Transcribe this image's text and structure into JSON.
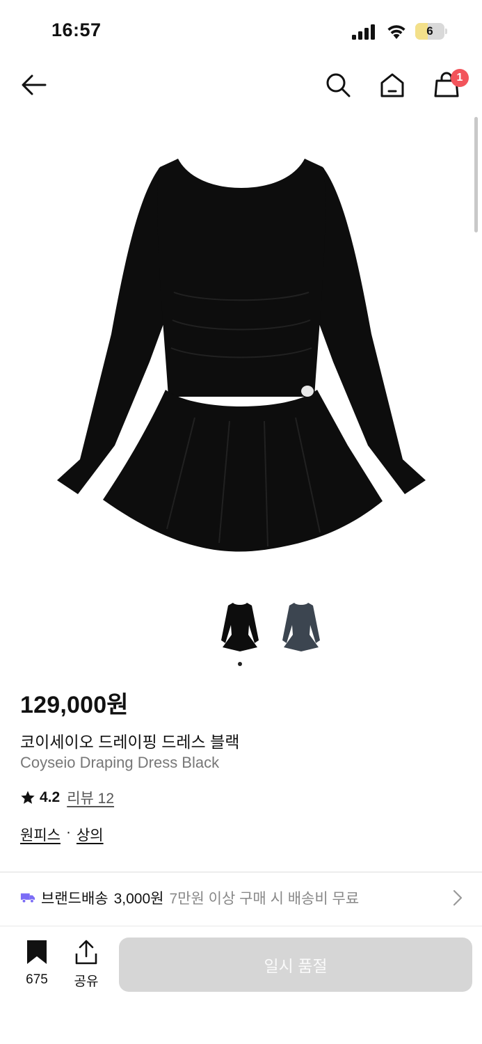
{
  "status_bar": {
    "time": "16:57",
    "battery_level": "6",
    "icons": [
      "signal-icon",
      "wifi-icon",
      "battery-icon"
    ]
  },
  "nav": {
    "icons": [
      "back-arrow-icon",
      "search-icon",
      "home-icon",
      "shopping-bag-icon"
    ],
    "cart_count": "1"
  },
  "product": {
    "price": "129,000원",
    "name_ko": "코이세이오 드레이핑 드레스 블랙",
    "name_en": "Coyseio Draping Dress Black",
    "rating": "4.2",
    "review_label": "리뷰 12",
    "category_1": "원피스",
    "category_separator": "·",
    "category_2": "상의",
    "thumbnails": [
      "black",
      "charcoal"
    ],
    "selected_thumbnail_index": 0
  },
  "shipping": {
    "brand_label": "브랜드배송",
    "fee": "3,000원",
    "note": "7만원 이상 구매 시 배송비 무료",
    "icon": "truck-icon"
  },
  "bottom_bar": {
    "bookmark_count": "675",
    "share_label": "공유",
    "cta_label": "일시 품절"
  },
  "colors": {
    "badge": "#f2545b",
    "truck": "#7b6cf6",
    "disabled_button": "#d6d6d6",
    "dress_black": "#0d0d0d",
    "dress_charcoal": "#3c4550"
  }
}
